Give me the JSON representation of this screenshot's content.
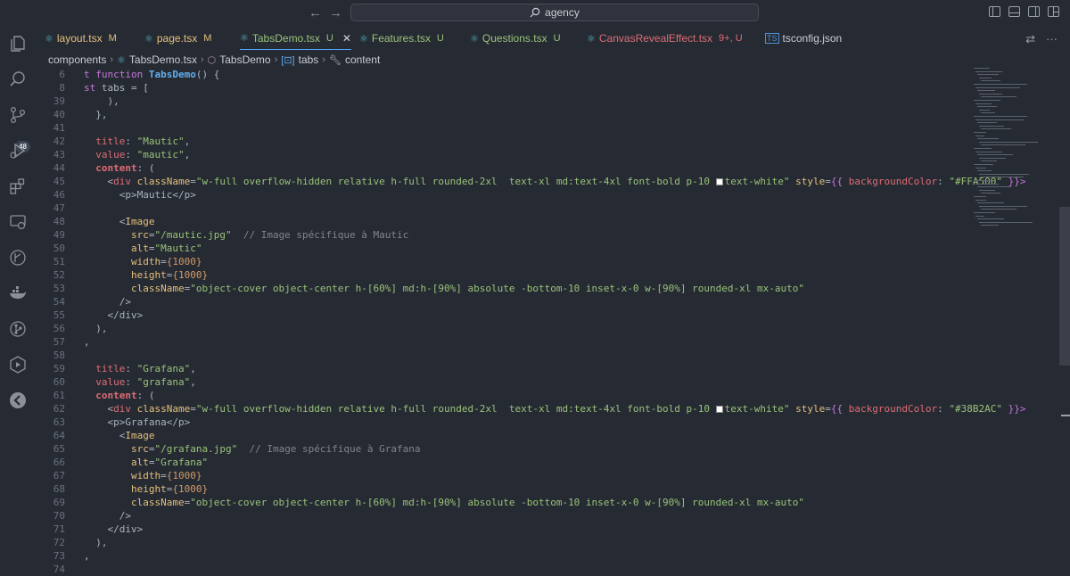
{
  "titlebar": {
    "search_text": "agency"
  },
  "activity": {
    "source_control_badge": "48"
  },
  "tabs": [
    {
      "label": "layout.tsx",
      "status": "M",
      "color": "#e5c07b"
    },
    {
      "label": "page.tsx",
      "status": "M",
      "color": "#e5c07b"
    },
    {
      "label": "TabsDemo.tsx",
      "status": "U",
      "color": "#98c379"
    },
    {
      "label": "Features.tsx",
      "status": "U",
      "color": "#98c379"
    },
    {
      "label": "Questions.tsx",
      "status": "U",
      "color": "#98c379"
    },
    {
      "label": "CanvasRevealEffect.tsx",
      "status": "9+, U",
      "color": "#e06c75"
    },
    {
      "label": "tsconfig.json",
      "status": "",
      "color": "#c9ccd3"
    }
  ],
  "breadcrumb": [
    "components",
    "TabsDemo.tsx",
    "TabsDemo",
    "tabs",
    "content"
  ],
  "line_numbers": [
    "6",
    "8",
    "39",
    "40",
    "41",
    "42",
    "43",
    "44",
    "45",
    "46",
    "47",
    "48",
    "49",
    "50",
    "51",
    "52",
    "53",
    "54",
    "55",
    "56",
    "57",
    "58",
    "59",
    "60",
    "61",
    "62",
    "63",
    "64",
    "65",
    "66",
    "67",
    "68",
    "69",
    "70",
    "71",
    "72",
    "73",
    "74"
  ],
  "code": {
    "l6_kw": "t function",
    "l6_fn": "TabsDemo",
    "l6_rest": "() {",
    "l8_kw": "st",
    "l8_rest": " tabs = [",
    "l39": "    ),",
    "l40": "  },",
    "l42_prop": "title",
    "l42_str": "\"Mautic\"",
    "l43_prop": "value",
    "l43_str": "\"mautic\"",
    "l44_prop": "content",
    "l44_rest": ": (",
    "div_open": "div",
    "classname": "className",
    "div_class": "\"w-full overflow-hidden relative h-full rounded-2xl  text-xl md:text-4xl font-bold p-10 ",
    "div_class_end": "text-white\"",
    "style_attr": "style",
    "style_open": "{{ ",
    "bg_key": "backgroundColor",
    "bg_mautic": "\"#FFA500\"",
    "style_close": " }}>",
    "p_mautic": "<p>Mautic</p>",
    "image_tag": "Image",
    "src_attr": "src",
    "src_mautic": "\"/mautic.jpg\"",
    "cmt_mautic": "// Image spécifique à Mautic",
    "alt_attr": "alt",
    "alt_mautic": "\"Mautic\"",
    "width_attr": "width",
    "height_attr": "height",
    "dim_value": "{1000}",
    "img_class": "\"object-cover object-center h-[60%] md:h-[90%] absolute -bottom-10 inset-x-0 w-[90%] rounded-xl mx-auto\"",
    "self_close": "/>",
    "div_close": "</div>",
    "paren_close": "),",
    "brace_close": ",",
    "l59_str": "\"Grafana\"",
    "l60_str": "\"grafana\"",
    "bg_grafana": "\"#38B2AC\"",
    "p_grafana": "<p>Grafana</p>",
    "src_grafana": "\"/grafana.jpg\"",
    "cmt_grafana": "// Image spécifique à Grafana",
    "alt_grafana": "\"Grafana\""
  }
}
